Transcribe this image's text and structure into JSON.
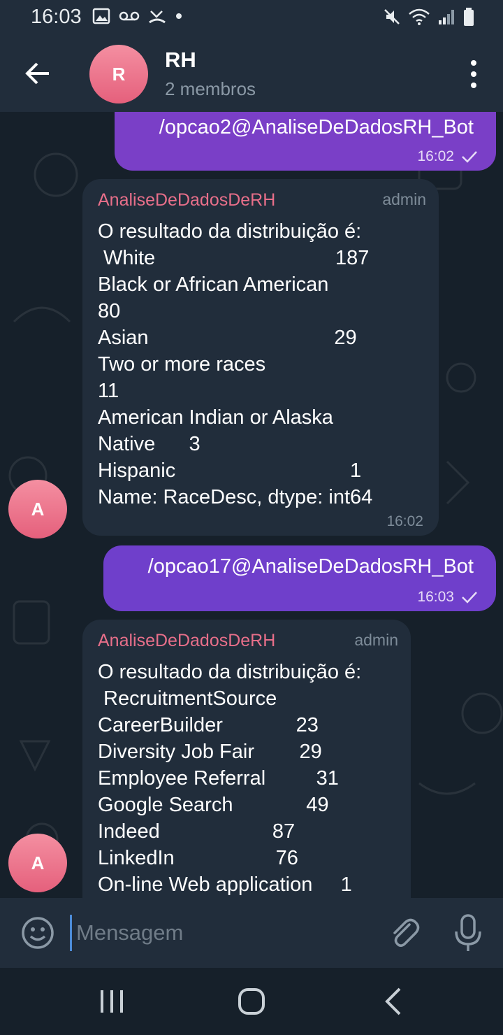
{
  "status_bar": {
    "time": "16:03",
    "left_icons": [
      "image-icon",
      "voicemail-icon",
      "missed-call-icon",
      "dot-icon"
    ],
    "right_icons": [
      "mute-icon",
      "wifi-icon",
      "signal-icon",
      "battery-icon"
    ]
  },
  "header": {
    "avatar_letter": "R",
    "title": "RH",
    "subtitle": "2 membros"
  },
  "messages": [
    {
      "type": "outgoing",
      "text": "/opcao2@AnaliseDeDadosRH_Bot",
      "time": "16:02"
    },
    {
      "type": "incoming",
      "sender": "AnaliseDeDadosDeRH",
      "role": "admin",
      "avatar_letter": "A",
      "lines": [
        "O resultado da distribuição é:",
        " White                                187",
        "Black or African American",
        "80",
        "Asian                                 29",
        "Two or more races",
        "11",
        "American Indian or Alaska",
        "Native      3",
        "Hispanic                               1",
        "Name: RaceDesc, dtype: int64"
      ],
      "time": "16:02"
    },
    {
      "type": "outgoing",
      "text": "/opcao17@AnaliseDeDadosRH_Bot",
      "time": "16:03"
    },
    {
      "type": "incoming",
      "sender": "AnaliseDeDadosDeRH",
      "role": "admin",
      "avatar_letter": "A",
      "lines": [
        "O resultado da distribuição é:",
        " RecruitmentSource",
        "CareerBuilder             23",
        "Diversity Job Fair        29",
        "Employee Referral         31",
        "Google Search             49",
        "Indeed                    87",
        "LinkedIn                  76",
        "On-line Web application     1"
      ]
    }
  ],
  "composer": {
    "placeholder": "Mensagem"
  },
  "colors": {
    "outgoing_bubble": "#7a3fc7",
    "incoming_bubble": "#212d3b",
    "sender_name": "#e86f8a",
    "header_bg": "#212d3b",
    "chat_bg": "#16202a"
  }
}
